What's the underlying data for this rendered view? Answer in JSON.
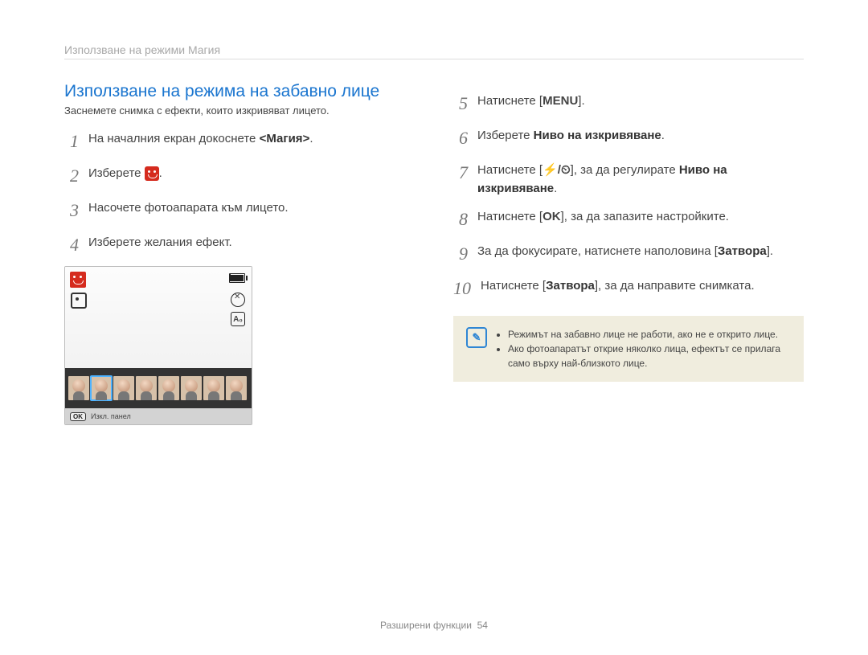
{
  "header": {
    "breadcrumb": "Използване на режими Магия"
  },
  "title": "Използване на режима на забавно лице",
  "intro": "Заснемете снимка с ефекти, които изкривяват лицето.",
  "steps_left": [
    {
      "n": "1",
      "pre": "На началния екран докоснете ",
      "bold": "<Магия>",
      "post": "."
    },
    {
      "n": "2",
      "pre": "Изберете ",
      "icon": "smiley",
      "post": "."
    },
    {
      "n": "3",
      "pre": "Насочете фотоапарата към лицето."
    },
    {
      "n": "4",
      "pre": "Изберете желания ефект."
    }
  ],
  "steps_right": [
    {
      "n": "5",
      "pre": "Натиснете [",
      "glyph": "MENU",
      "post": "]."
    },
    {
      "n": "6",
      "pre": "Изберете ",
      "bold": "Ниво на изкривяване",
      "post": "."
    },
    {
      "n": "7",
      "pre": "Натиснете [",
      "glyph": "⚡/⏲",
      "post": "], за да регулирате ",
      "bold": "Ниво на изкривяване",
      "post2": "."
    },
    {
      "n": "8",
      "pre": "Натиснете [",
      "glyph": "OK",
      "post": "], за да запазите настройките."
    },
    {
      "n": "9",
      "pre": "За да фокусирате, натиснете наполовина [",
      "bold": "Затвора",
      "post": "]."
    },
    {
      "n": "10",
      "pre": "Натиснете [",
      "bold": "Затвора",
      "post": "], за да направите снимката."
    }
  ],
  "camera": {
    "footer_label": "Изкл. панел",
    "ok": "OK",
    "flash": "A₀"
  },
  "note": {
    "items": [
      "Режимът на забавно лице не работи, ако не е открито лице.",
      "Ако фотоапаратът открие няколко лица, ефектът се прилага само върху най-близкото лице."
    ]
  },
  "footer": {
    "section": "Разширени функции",
    "page": "54"
  }
}
